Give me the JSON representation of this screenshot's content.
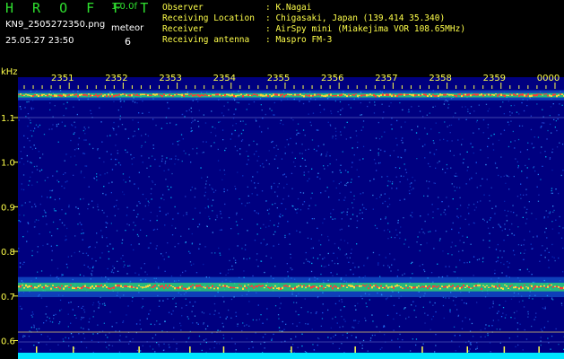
{
  "app": {
    "title": "H R O F F T",
    "version": "1.0.0f"
  },
  "file": {
    "name": "KN9_2505272350.png",
    "datetime": "25.05.27 23:50"
  },
  "meteor": {
    "label": "meteor",
    "count": "6"
  },
  "info": [
    {
      "label": "Observer",
      "value": ": K.Nagai"
    },
    {
      "label": "Receiving Location",
      "value": ": Chigasaki, Japan (139.414 35.340)"
    },
    {
      "label": "Receiver",
      "value": ": AirSpy mini (Miakejima VOR 108.65MHz)"
    },
    {
      "label": "Receiving antenna",
      "value": ": Maspro FM-3"
    }
  ],
  "spectrogram": {
    "y_unit": "kHz",
    "y_ticks": [
      "1.1",
      "1.0",
      "0.9",
      "0.8",
      "0.7",
      "0.6"
    ],
    "y_tick_values": [
      1.1,
      1.0,
      0.9,
      0.8,
      0.7,
      0.6
    ],
    "time_labels": [
      "2351",
      "2352",
      "2353",
      "2354",
      "2355",
      "2356",
      "2357",
      "2358",
      "2359",
      "0000"
    ],
    "signal_lines_khz": [
      1.15,
      0.72
    ],
    "colors": {
      "background": "#000080",
      "noise": "#1e6cff",
      "signal": "#ff3b3b",
      "text_yellow": "#ffff4a",
      "text_green": "#2fe02f",
      "baseline": "#00e5ff"
    }
  }
}
